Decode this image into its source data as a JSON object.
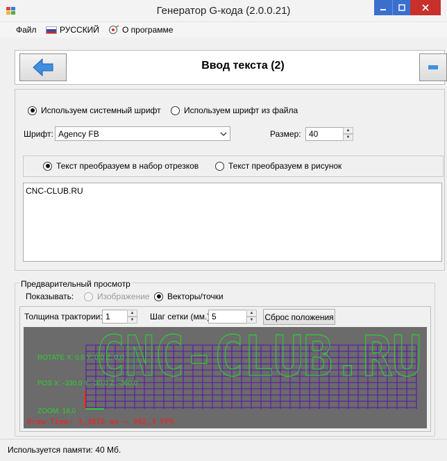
{
  "window": {
    "title": "Генератор G-кода (2.0.0.21)",
    "min_icon": "minimize-icon",
    "max_icon": "maximize-icon",
    "close_icon": "close-icon"
  },
  "menu": {
    "file": "Файл",
    "language": "РУССКИЙ",
    "about": "О программе"
  },
  "header": {
    "title": "Ввод текста (2)"
  },
  "font_source": {
    "system": "Используем системный шрифт",
    "file": "Используем шрифт из файла",
    "selected": "system"
  },
  "font": {
    "label": "Шрифт:",
    "value": "Agency FB"
  },
  "size": {
    "label": "Размер:",
    "value": "40"
  },
  "convert": {
    "segments": "Текст преобразуем в набор отрезков",
    "picture": "Текст преобразуем в рисунок",
    "selected": "segments"
  },
  "text_input": {
    "value": "CNC-CLUB.RU"
  },
  "preview": {
    "legend": "Предварительный просмотр",
    "show_label": "Показывать:",
    "image_option": "Изображение",
    "vectors_option": "Векторы/точки",
    "thickness_label": "Толщина трактории:",
    "thickness_value": "1",
    "grid_label": "Шаг сетки (мм.):",
    "grid_value": "5",
    "reset_button": "Сброс положения",
    "overlay": {
      "rotate": "ROTATE X: 0,0 Y: 0,0 Z: 0,0",
      "pos": "POS X: -330,0 Y: -30,0 Z: -360,0",
      "zoom": "ZOOM: 18,0",
      "draw_time": "Draw Time: 3,3076 ms ~ 302,3 FPS",
      "preview_text": "CNC-CLUB.RU"
    },
    "colors": {
      "canvas": "#6b6b6b",
      "grid": "#5a0fb0",
      "text": "#2bd12b",
      "overlay": "#2bd12b",
      "draw_time": "#ff1a1a"
    }
  },
  "status": {
    "memory": "Используется памяти:  40  Мб."
  }
}
